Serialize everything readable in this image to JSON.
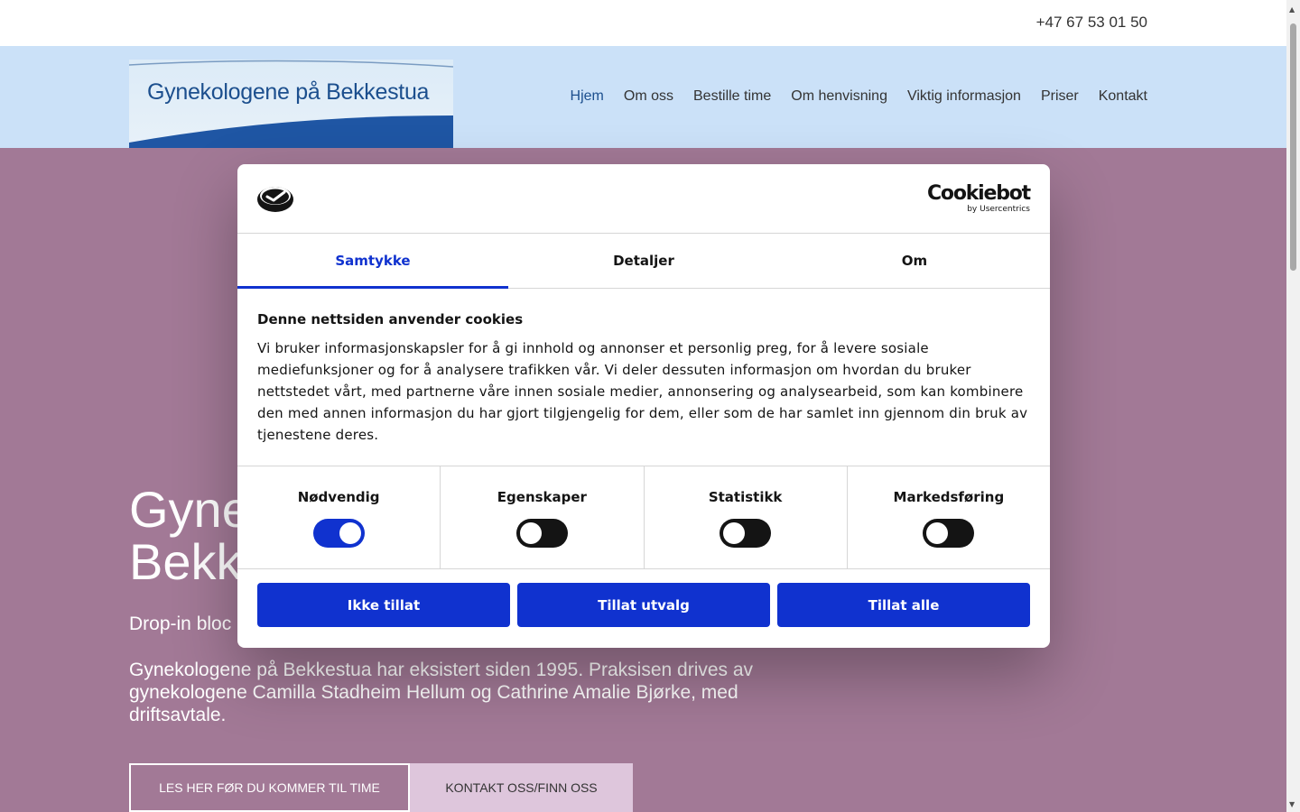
{
  "topbar": {
    "phone": "+47 67 53 01 50"
  },
  "logo": {
    "text": "Gynekologene på Bekkestua"
  },
  "nav": {
    "items": [
      {
        "label": "Hjem",
        "active": true
      },
      {
        "label": "Om oss"
      },
      {
        "label": "Bestille time"
      },
      {
        "label": "Om henvisning"
      },
      {
        "label": "Viktig informasjon"
      },
      {
        "label": "Priser"
      },
      {
        "label": "Kontakt"
      }
    ]
  },
  "hero": {
    "title_line1": "Gyne",
    "title_line2": "Bekk",
    "subtitle": "Drop-in bloc",
    "body": "Gynekologene på Bekkestua har eksistert siden 1995. Praksisen drives av gynekologene Camilla Stadheim Hellum og Cathrine Amalie Bjørke, med driftsavtale.",
    "button_primary": "LES HER FØR DU KOMMER TIL TIME",
    "button_secondary": "KONTAKT OSS/FINN OSS"
  },
  "cookie": {
    "brand_name": "Cookiebot",
    "brand_by": "by Usercentrics",
    "tabs": [
      "Samtykke",
      "Detaljer",
      "Om"
    ],
    "heading": "Denne nettsiden anvender cookies",
    "text": "Vi bruker informasjonskapsler for å gi innhold og annonser et personlig preg, for å levere sosiale mediefunksjoner og for å analysere trafikken vår. Vi deler dessuten informasjon om hvordan du bruker nettstedet vårt, med partnerne våre innen sosiale medier, annonsering og analysearbeid, som kan kombinere den med annen informasjon du har gjort tilgjengelig for dem, eller som de har samlet inn gjennom din bruk av tjenestene deres.",
    "toggles": [
      {
        "label": "Nødvendig",
        "on": true
      },
      {
        "label": "Egenskaper",
        "on": false
      },
      {
        "label": "Statistikk",
        "on": false
      },
      {
        "label": "Markedsføring",
        "on": false
      }
    ],
    "actions": [
      "Ikke tillat",
      "Tillat utvalg",
      "Tillat alle"
    ]
  },
  "colors": {
    "accent": "#1032cf",
    "header_bg": "#cbe1f8",
    "hero_bg": "#a27996",
    "logo_blue": "#1c4f8e"
  }
}
